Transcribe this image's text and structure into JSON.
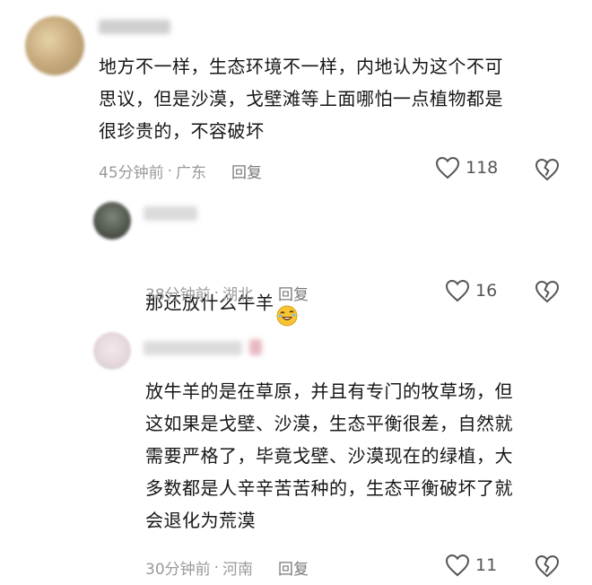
{
  "comments": [
    {
      "text": "地方不一样，生态环境不一样，内地认为这个不可\n思议，但是沙漠，戈壁滩等上面哪怕一点植物都是\n很珍贵的，不容破坏",
      "time": "45分钟前",
      "location": "广东",
      "reply_label": "回复",
      "likes": "118"
    },
    {
      "text": "那还放什么牛羊",
      "emoji": "rolling-laughing-emoji",
      "time": "38分钟前",
      "location": "湖北",
      "reply_label": "回复",
      "likes": "16"
    },
    {
      "text": "放牛羊的是在草原，并且有专门的牧草场，但\n这如果是戈壁、沙漠，生态平衡很差，自然就\n需要严格了，毕竟戈壁、沙漠现在的绿植，大\n多数都是人辛辛苦苦种的，生态平衡破坏了就\n会退化为荒漠",
      "time": "30分钟前",
      "location": "河南",
      "reply_label": "回复",
      "likes": "11"
    }
  ],
  "meta_separator": "·",
  "icons": {
    "like": "heart-outline-icon",
    "dislike": "broken-heart-icon"
  },
  "colors": {
    "meta_text": "#9a9a9a",
    "content_text": "#161616",
    "icon_stroke": "#555555"
  }
}
